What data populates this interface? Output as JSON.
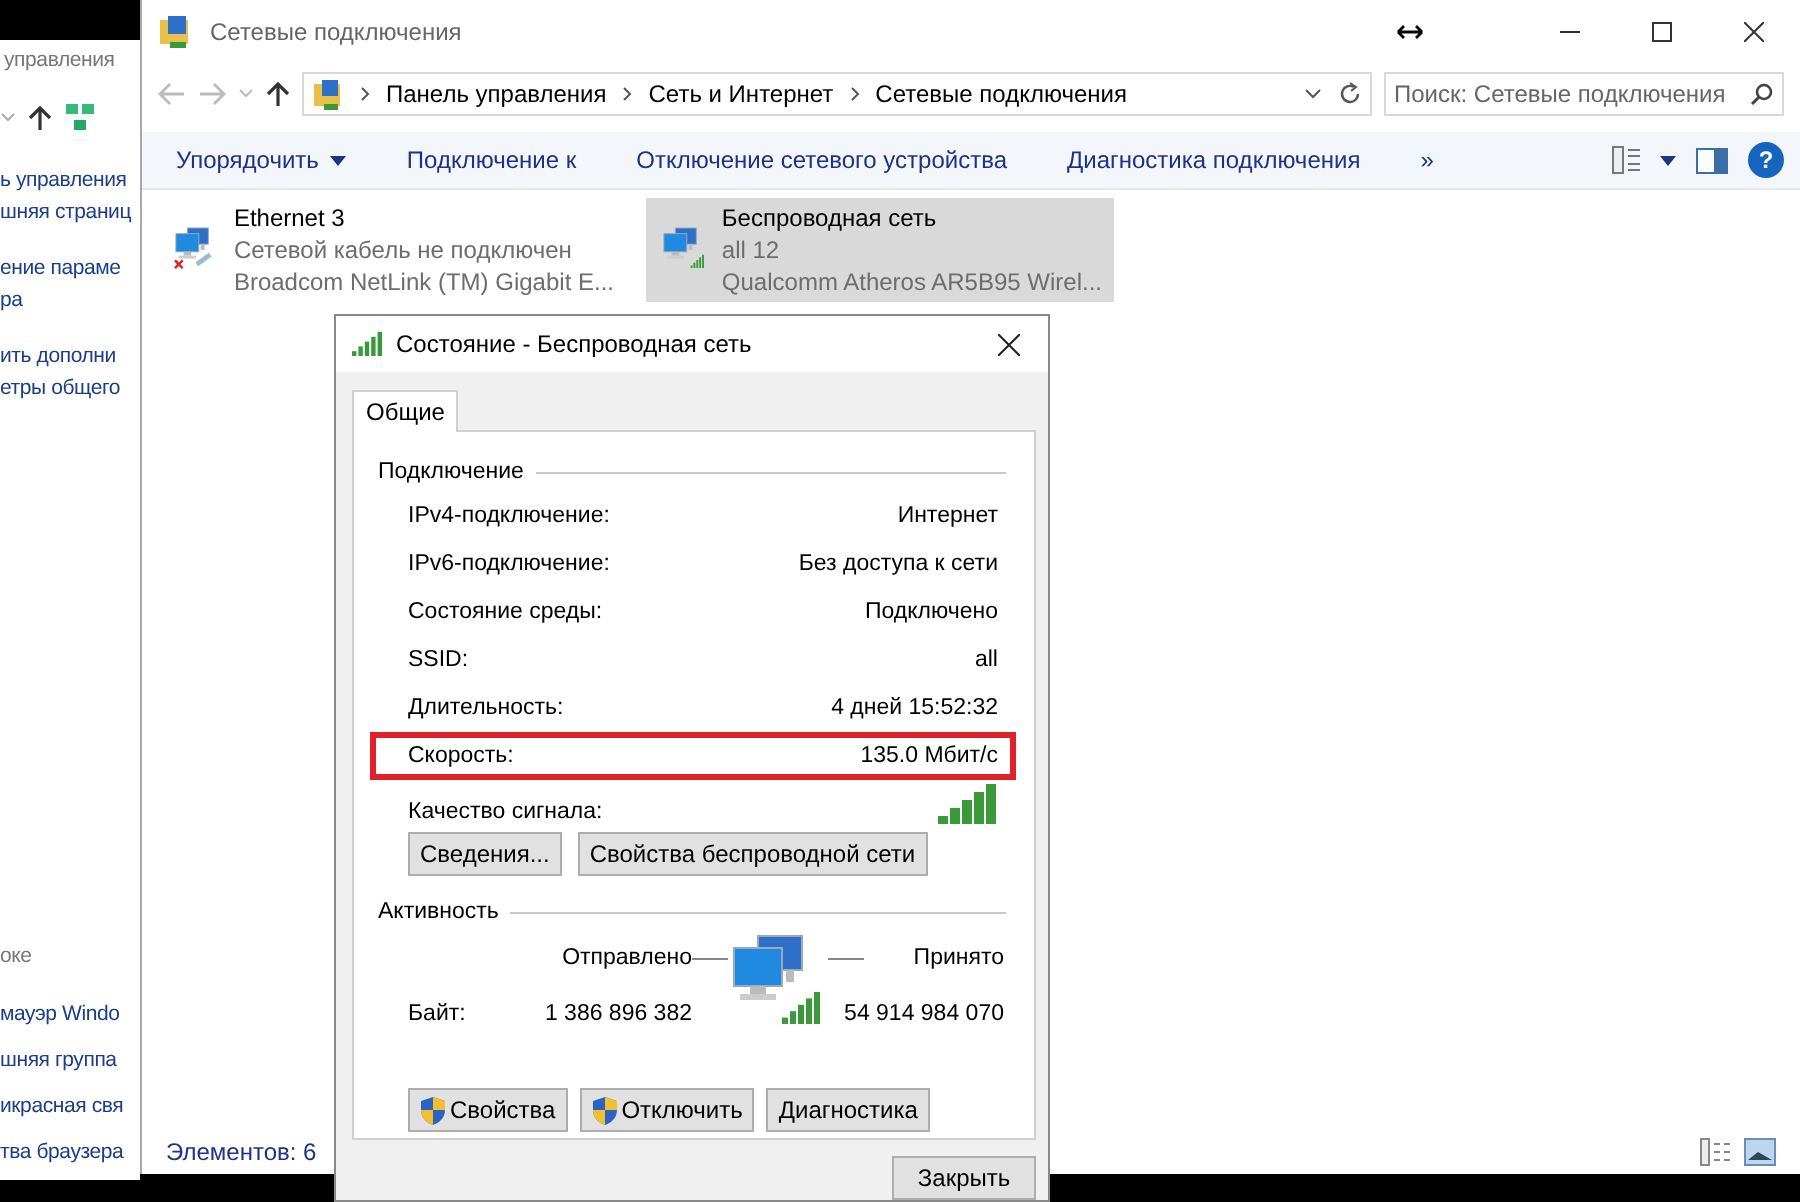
{
  "back_window": {
    "title": "управления",
    "links": [
      "ь управления",
      "шняя страниц",
      "ение параме",
      "ра",
      "ить дополни",
      "етры общего"
    ],
    "see_also_heading": "оке",
    "see_also_links": [
      "мауэр Windo",
      "шняя группа",
      "икрасная свя",
      "тва браузера"
    ]
  },
  "window": {
    "title": "Сетевые подключения",
    "breadcrumb": [
      "Панель управления",
      "Сеть и Интернет",
      "Сетевые подключения"
    ],
    "search": {
      "placeholder": "Поиск: Сетевые подключения"
    },
    "toolbar": [
      {
        "label": "Упорядочить",
        "dropdown": true
      },
      {
        "label": "Подключение к",
        "dropdown": false
      },
      {
        "label": "Отключение сетевого устройства",
        "dropdown": false
      },
      {
        "label": "Диагностика подключения",
        "dropdown": false
      }
    ],
    "more": "»",
    "help": "?"
  },
  "connections": [
    {
      "name": "Ethernet 3",
      "status": "Сетевой кабель не подключен",
      "device": "Broadcom NetLink (TM) Gigabit E...",
      "kind": "wired",
      "selected": false
    },
    {
      "name": "Беспроводная сеть",
      "status": "all  12",
      "device": "Qualcomm Atheros AR5B95 Wirel...",
      "kind": "wireless",
      "selected": true
    }
  ],
  "status_bar": {
    "count": "Элементов: 6"
  },
  "dialog": {
    "title": "Состояние - Беспроводная сеть",
    "tabs": [
      {
        "label": "Общие",
        "selected": true
      }
    ],
    "connection": {
      "heading": "Подключение",
      "rows": [
        {
          "label": "IPv4-подключение:",
          "value": "Интернет",
          "highlighted": false
        },
        {
          "label": "IPv6-подключение:",
          "value": "Без доступа к сети",
          "highlighted": false
        },
        {
          "label": "Состояние среды:",
          "value": "Подключено",
          "highlighted": false
        },
        {
          "label": "SSID:",
          "value": "all",
          "highlighted": false
        },
        {
          "label": "Длительность:",
          "value": "4 дней 15:52:32",
          "highlighted": false
        },
        {
          "label": "Скорость:",
          "value": "135.0 Мбит/с",
          "highlighted": true
        }
      ],
      "signal_label": "Качество сигнала:"
    },
    "buttons": [
      "Сведения...",
      "Свойства беспроводной сети"
    ],
    "activity": {
      "heading": "Активность",
      "sent_label": "Отправлено",
      "received_label": "Принято",
      "bytes_label": "Байт:",
      "bytes_sent": "1 386 896 382",
      "bytes_received": "54 914 984 070"
    },
    "action_buttons": [
      {
        "label": "Свойства",
        "shield": true
      },
      {
        "label": "Отключить",
        "shield": true
      },
      {
        "label": "Диагностика",
        "shield": false
      }
    ],
    "close_button": "Закрыть"
  }
}
